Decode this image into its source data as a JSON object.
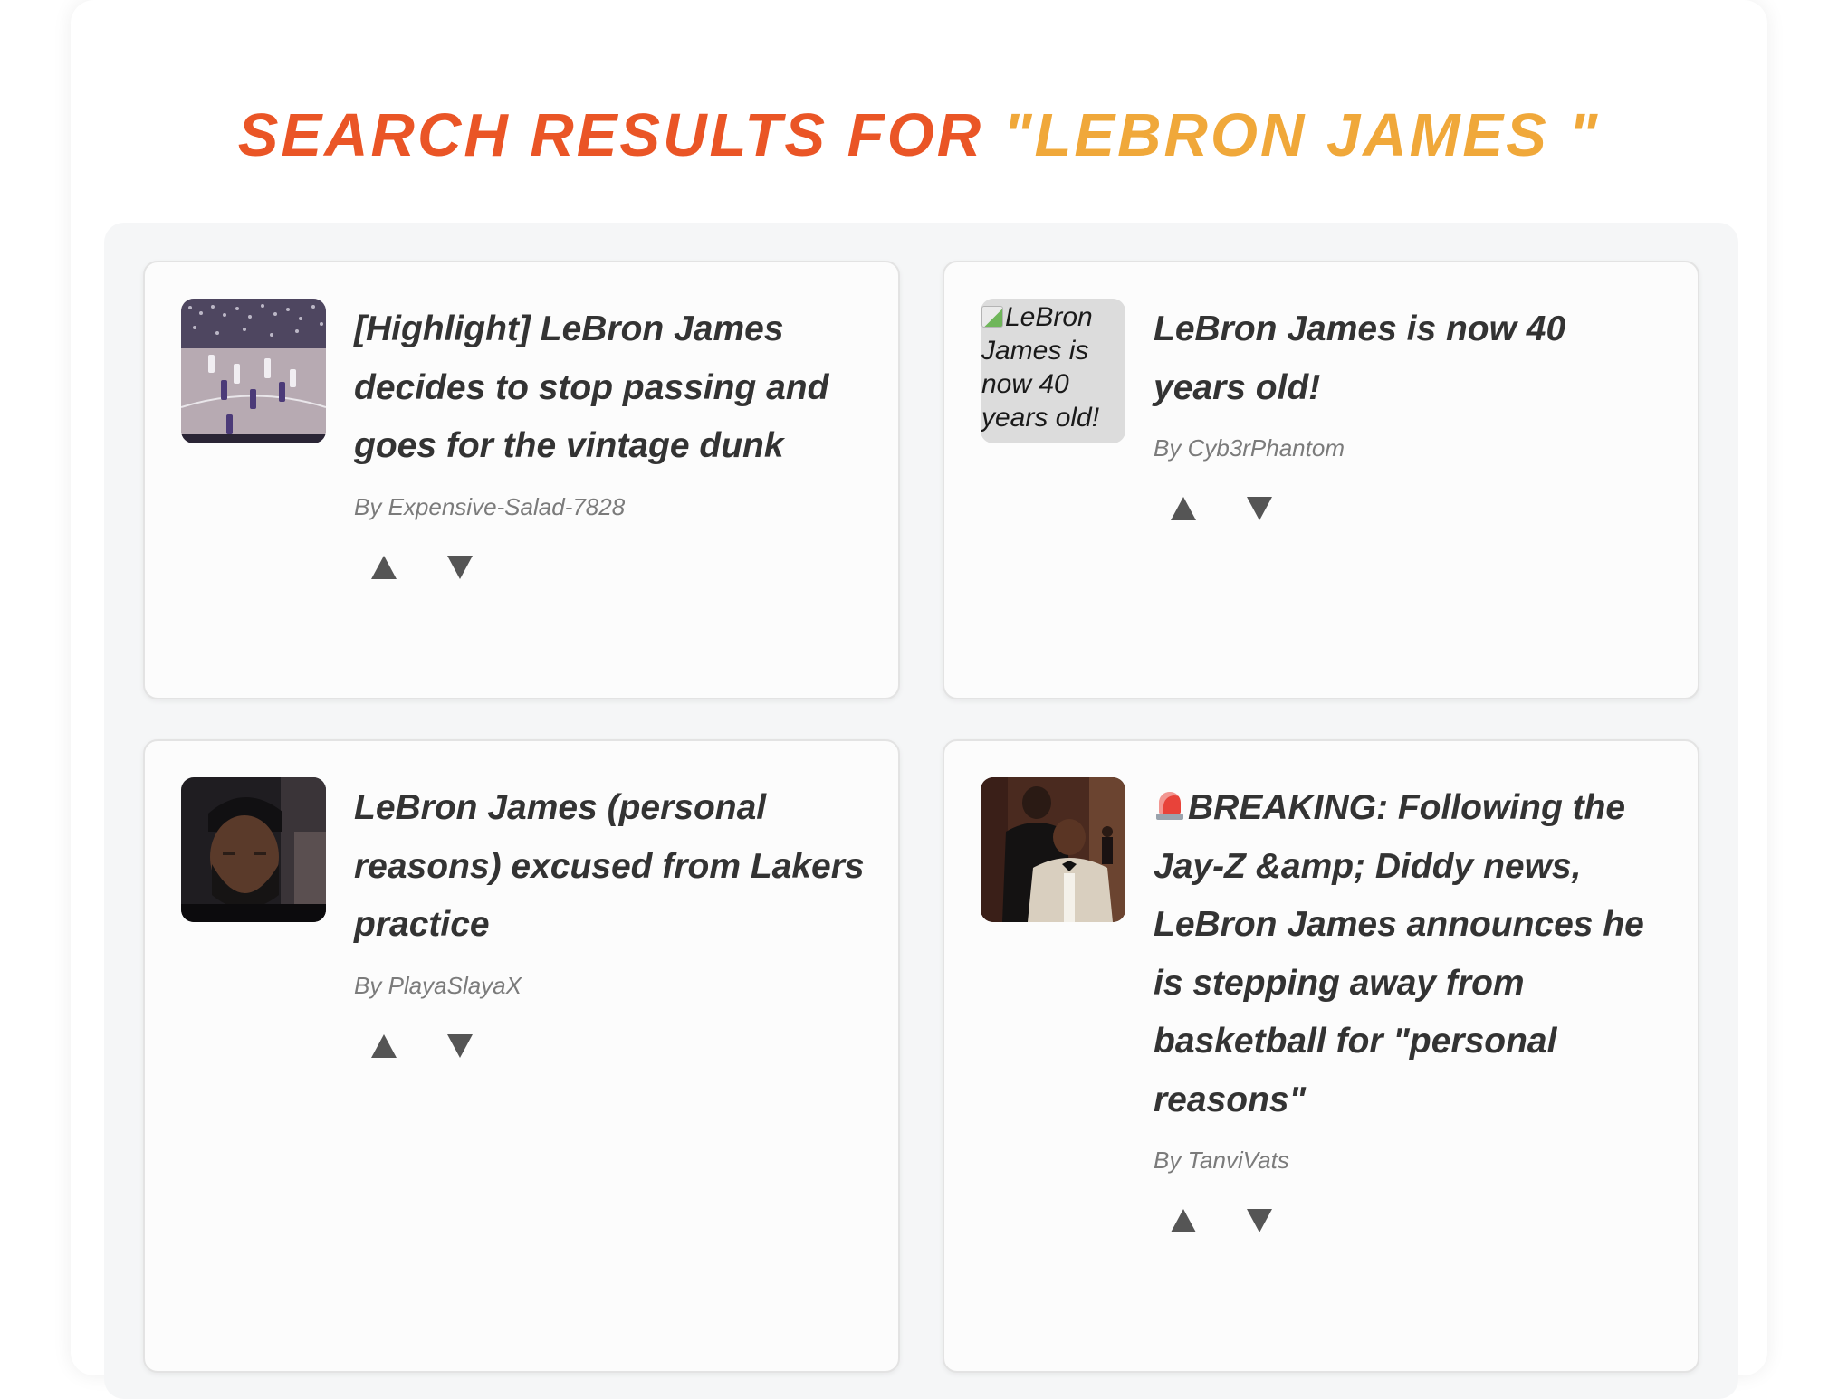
{
  "header": {
    "title_prefix": "Search Results for ",
    "query": "\"LEBRON JAMES \"",
    "colors": {
      "prefix": "#ea5526",
      "query": "#f0a83a"
    }
  },
  "results": [
    {
      "title": "[Highlight] LeBron James decides to stop passing and goes for the vintage dunk",
      "author": "By Expensive-Salad-7828",
      "thumbnail": "basketball-court-photo"
    },
    {
      "title": "LeBron James is now 40 years old!",
      "author": "By Cyb3rPhantom",
      "thumbnail": "broken-image",
      "thumbnail_alt": "LeBron James is now 40 years old!"
    },
    {
      "title": "LeBron James (personal reasons) excused from Lakers practice",
      "author": "By PlayaSlayaX",
      "thumbnail": "portrait-photo"
    },
    {
      "title": "BREAKING: Following the Jay-Z &amp; Diddy news, LeBron James announces he is stepping away from basketball for \"personal reasons\"",
      "author": "By TanviVats",
      "thumbnail": "event-photo",
      "title_icon": "rotating-light-icon"
    }
  ],
  "vote": {
    "up_symbol": "▲",
    "down_symbol": "▼"
  }
}
